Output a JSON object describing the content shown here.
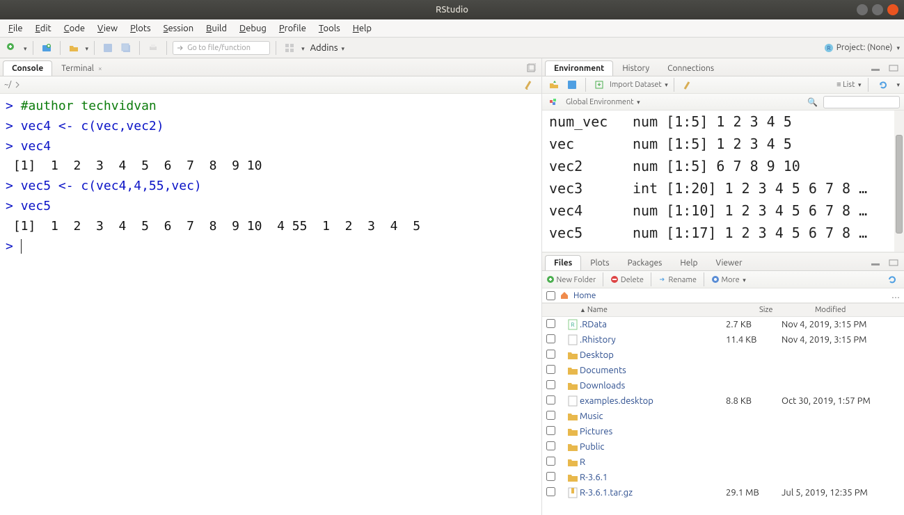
{
  "window": {
    "title": "RStudio"
  },
  "menubar": [
    "File",
    "Edit",
    "Code",
    "View",
    "Plots",
    "Session",
    "Build",
    "Debug",
    "Profile",
    "Tools",
    "Help"
  ],
  "toolbar": {
    "goto_placeholder": "Go to file/function",
    "addins_label": "Addins",
    "project_label": "Project: (None)"
  },
  "left": {
    "tabs": [
      {
        "label": "Console",
        "active": true
      },
      {
        "label": "Terminal",
        "active": false,
        "closable": true
      }
    ],
    "cwd": "~/",
    "console_lines": [
      {
        "t": "cmd",
        "text": "#author techvidvan"
      },
      {
        "t": "cmd",
        "text": "vec4 <- c(vec,vec2)"
      },
      {
        "t": "cmd",
        "text": "vec4"
      },
      {
        "t": "out",
        "text": " [1]  1  2  3  4  5  6  7  8  9 10"
      },
      {
        "t": "cmd",
        "text": "vec5 <- c(vec4,4,55,vec)"
      },
      {
        "t": "cmd",
        "text": "vec5"
      },
      {
        "t": "out",
        "text": " [1]  1  2  3  4  5  6  7  8  9 10  4 55  1  2  3  4  5"
      },
      {
        "t": "prompt",
        "text": ""
      }
    ]
  },
  "env": {
    "tabs": [
      {
        "label": "Environment",
        "active": true
      },
      {
        "label": "History"
      },
      {
        "label": "Connections"
      }
    ],
    "import_label": "Import Dataset",
    "view_label": "List",
    "scope_label": "Global Environment",
    "vars": [
      {
        "name": "num_vec",
        "value": "num [1:5] 1 2 3 4 5"
      },
      {
        "name": "vec",
        "value": "num [1:5] 1 2 3 4 5"
      },
      {
        "name": "vec2",
        "value": "num [1:5] 6 7 8 9 10"
      },
      {
        "name": "vec3",
        "value": "int [1:20] 1 2 3 4 5 6 7 8 …"
      },
      {
        "name": "vec4",
        "value": "num [1:10] 1 2 3 4 5 6 7 8 …"
      },
      {
        "name": "vec5",
        "value": "num [1:17] 1 2 3 4 5 6 7 8 …"
      }
    ]
  },
  "files": {
    "tabs": [
      {
        "label": "Files",
        "active": true
      },
      {
        "label": "Plots"
      },
      {
        "label": "Packages"
      },
      {
        "label": "Help"
      },
      {
        "label": "Viewer"
      }
    ],
    "newfolder_label": "New Folder",
    "delete_label": "Delete",
    "rename_label": "Rename",
    "more_label": "More",
    "breadcrumb": "Home",
    "cols": {
      "name": "Name",
      "size": "Size",
      "mod": "Modified"
    },
    "rows": [
      {
        "icon": "rdata",
        "name": ".RData",
        "size": "2.7 KB",
        "mod": "Nov 4, 2019, 3:15 PM"
      },
      {
        "icon": "text",
        "name": ".Rhistory",
        "size": "11.4 KB",
        "mod": "Nov 4, 2019, 3:15 PM"
      },
      {
        "icon": "folder",
        "name": "Desktop",
        "size": "",
        "mod": ""
      },
      {
        "icon": "folder",
        "name": "Documents",
        "size": "",
        "mod": ""
      },
      {
        "icon": "folder",
        "name": "Downloads",
        "size": "",
        "mod": ""
      },
      {
        "icon": "text",
        "name": "examples.desktop",
        "size": "8.8 KB",
        "mod": "Oct 30, 2019, 1:57 PM"
      },
      {
        "icon": "folder",
        "name": "Music",
        "size": "",
        "mod": ""
      },
      {
        "icon": "folder",
        "name": "Pictures",
        "size": "",
        "mod": ""
      },
      {
        "icon": "folder-pub",
        "name": "Public",
        "size": "",
        "mod": ""
      },
      {
        "icon": "folder",
        "name": "R",
        "size": "",
        "mod": ""
      },
      {
        "icon": "folder",
        "name": "R-3.6.1",
        "size": "",
        "mod": ""
      },
      {
        "icon": "archive",
        "name": "R-3.6.1.tar.gz",
        "size": "29.1 MB",
        "mod": "Jul 5, 2019, 12:35 PM"
      }
    ]
  }
}
